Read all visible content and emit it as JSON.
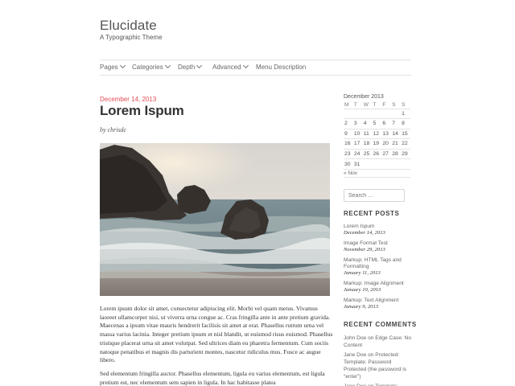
{
  "site": {
    "title": "Elucidate",
    "description": "A Typographic Theme"
  },
  "nav": {
    "items": [
      {
        "label": "Pages",
        "dropdown": true
      },
      {
        "label": "Categories",
        "dropdown": true
      },
      {
        "label": "Depth",
        "dropdown": true
      },
      {
        "label": "Advanced",
        "dropdown": true
      },
      {
        "label": "Menu Description",
        "dropdown": false
      }
    ]
  },
  "post": {
    "date": "December 14, 2013",
    "title": "Lorem Ispum",
    "author": "by chrisdc",
    "image_icon": "photo-rocky-beach",
    "paragraphs": [
      "Lorem ipsum dolor sit amet, consectetur adipiscing elit. Morbi vel quam metus. Vivamus laoreet ullamcorper nisi, ut viverra urna congue ac. Cras fringilla ante in ante pretium gravida. Maecenas a ipsum vitae mauris hendrerit facilisis sit amet at erat. Phasellus rutrum urna vel massa varius lacinia. Integer pretium ipsum et nisl blandit, ut euismod risus euismod. Phasellus tristique placerat urna sit amet volutpat. Sed ultrices diam eu pharetra fermentum. Cum sociis natoque penatibus et magnis dis parturient montes, nascetur ridiculus mus. Fusce ac augue libero.",
      "Sed elementum fringilla auctor. Phasellus elementum, ligula eu varius elementum, est ligula pretium est, nec elementum sem sapien in ligula. In hac habitasse platea"
    ]
  },
  "calendar": {
    "caption": "December 2013",
    "weekdays": [
      "M",
      "T",
      "W",
      "T",
      "F",
      "S",
      "S"
    ],
    "weeks": [
      [
        "",
        "",
        "",
        "",
        "",
        "",
        "1"
      ],
      [
        "2",
        "3",
        "4",
        "5",
        "6",
        "7",
        "8"
      ],
      [
        "9",
        "10",
        "11",
        "12",
        "13",
        "14",
        "15"
      ],
      [
        "16",
        "17",
        "18",
        "19",
        "20",
        "21",
        "22"
      ],
      [
        "23",
        "24",
        "25",
        "26",
        "27",
        "28",
        "29"
      ],
      [
        "30",
        "31",
        "",
        "",
        "",
        "",
        ""
      ]
    ],
    "prev_link": "« Nov"
  },
  "search": {
    "placeholder": "Search …"
  },
  "recent_posts": {
    "title": "RECENT POSTS",
    "items": [
      {
        "label": "Lorem Ispum",
        "date": "December 14, 2013"
      },
      {
        "label": "Image Format Test",
        "date": "November 29, 2013"
      },
      {
        "label": "Markup: HTML Tags and Formatting",
        "date": "January 11, 2013"
      },
      {
        "label": "Markup: Image Alignment",
        "date": "January 10, 2013"
      },
      {
        "label": "Markup: Text Alignment",
        "date": "January 9, 2013"
      }
    ]
  },
  "recent_comments": {
    "title": "RECENT COMMENTS",
    "items": [
      {
        "author": "John Doe",
        "on": "on",
        "post": "Edge Case: No Content"
      },
      {
        "author": "Jane Doe",
        "on": "on",
        "post": "Protected: Template: Password Protected (the password is “enter”)"
      },
      {
        "author": "Jane Doe",
        "on": "on",
        "post": "Template:"
      }
    ]
  }
}
